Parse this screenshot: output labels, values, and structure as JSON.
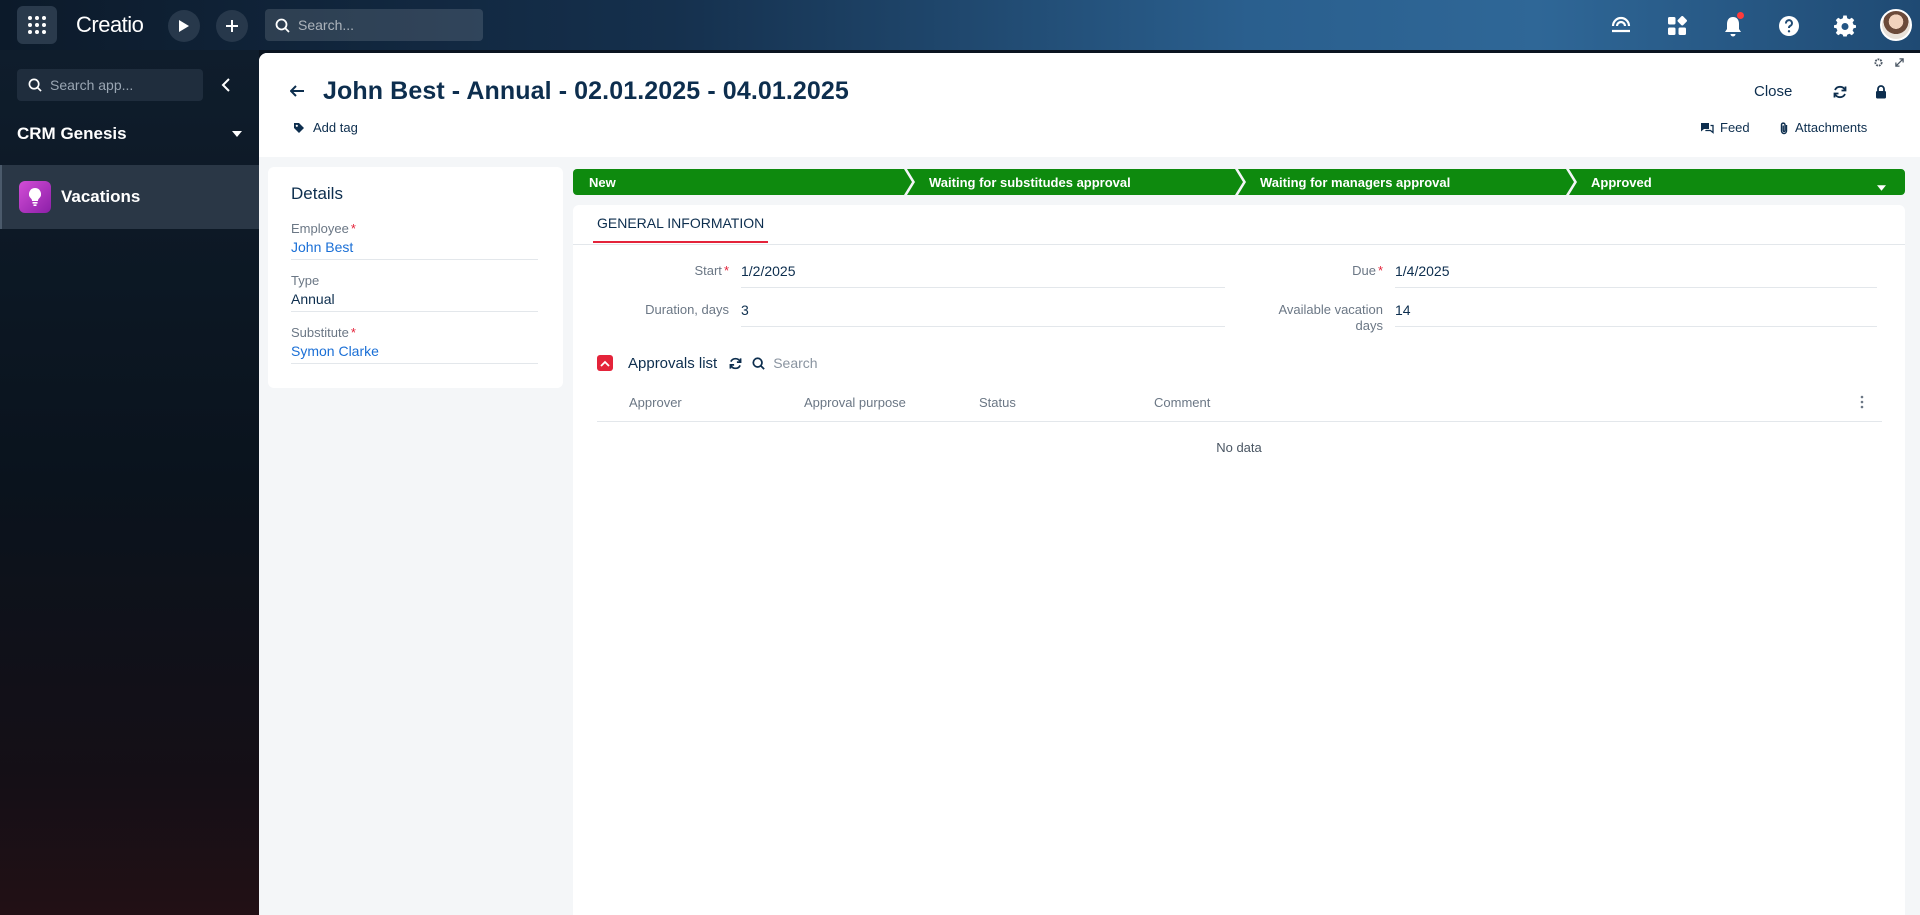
{
  "topbar": {
    "logo": "Creatio",
    "search_placeholder": "Search..."
  },
  "sidebar": {
    "search_placeholder": "Search app...",
    "workspace": "CRM Genesis",
    "items": [
      {
        "label": "Vacations"
      }
    ]
  },
  "header": {
    "title": "John Best - Annual - 02.01.2025 - 04.01.2025",
    "add_tag": "Add tag",
    "close": "Close",
    "feed": "Feed",
    "attachments": "Attachments"
  },
  "details": {
    "title": "Details",
    "fields": [
      {
        "label": "Employee",
        "value": "John Best",
        "required": true
      },
      {
        "label": "Type",
        "value": "Annual",
        "required": false
      },
      {
        "label": "Substitute",
        "value": "Symon Clarke",
        "required": true
      }
    ]
  },
  "stages": [
    "New",
    "Waiting for substitudes approval",
    "Waiting for managers approval",
    "Approved"
  ],
  "general": {
    "tab": "GENERAL INFORMATION",
    "start_label": "Start",
    "start_value": "1/2/2025",
    "due_label": "Due",
    "due_value": "1/4/2025",
    "duration_label": "Duration, days",
    "duration_value": "3",
    "available_label_1": "Available vacation",
    "available_label_2": "days",
    "available_value": "14"
  },
  "approvals": {
    "title": "Approvals list",
    "search_placeholder": "Search",
    "columns": [
      "Approver",
      "Approval purpose",
      "Status",
      "Comment"
    ],
    "empty": "No data"
  },
  "colors": {
    "stage_green": "#0e8a0e",
    "accent_red": "#e4233a",
    "link_blue": "#1a6fd6"
  }
}
